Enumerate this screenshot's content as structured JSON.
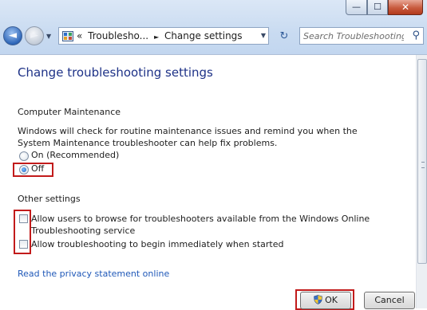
{
  "window": {
    "minimize_glyph": "—",
    "maximize_glyph": "☐",
    "close_glyph": "✕"
  },
  "nav": {
    "back_glyph": "◄",
    "forward_glyph": "►",
    "recent_glyph": "▼",
    "breadcrumb_prefix": "«",
    "breadcrumb_parent": "Troublesho...",
    "breadcrumb_sep": "►",
    "breadcrumb_current": "Change settings",
    "address_dropdown_glyph": "▼",
    "refresh_glyph": "↻",
    "search_placeholder": "Search Troubleshooting",
    "search_glyph": "⚲"
  },
  "page": {
    "title": "Change troubleshooting settings",
    "maintenance": {
      "heading": "Computer Maintenance",
      "description": "Windows will check for routine maintenance issues and remind you when the System Maintenance troubleshooter can help fix problems.",
      "option_on": "On (Recommended)",
      "option_off": "Off",
      "selected": "off"
    },
    "other": {
      "heading": "Other settings",
      "browse_online": "Allow users to browse for troubleshooters available from the Windows Online Troubleshooting service",
      "auto_start": "Allow troubleshooting to begin immediately when started",
      "browse_online_checked": false,
      "auto_start_checked": false
    },
    "privacy_link": "Read the privacy statement online"
  },
  "buttons": {
    "ok": "OK",
    "cancel": "Cancel"
  },
  "colors": {
    "highlight": "#c21b1b",
    "title_blue": "#1e3287",
    "link_blue": "#1f58b8"
  }
}
